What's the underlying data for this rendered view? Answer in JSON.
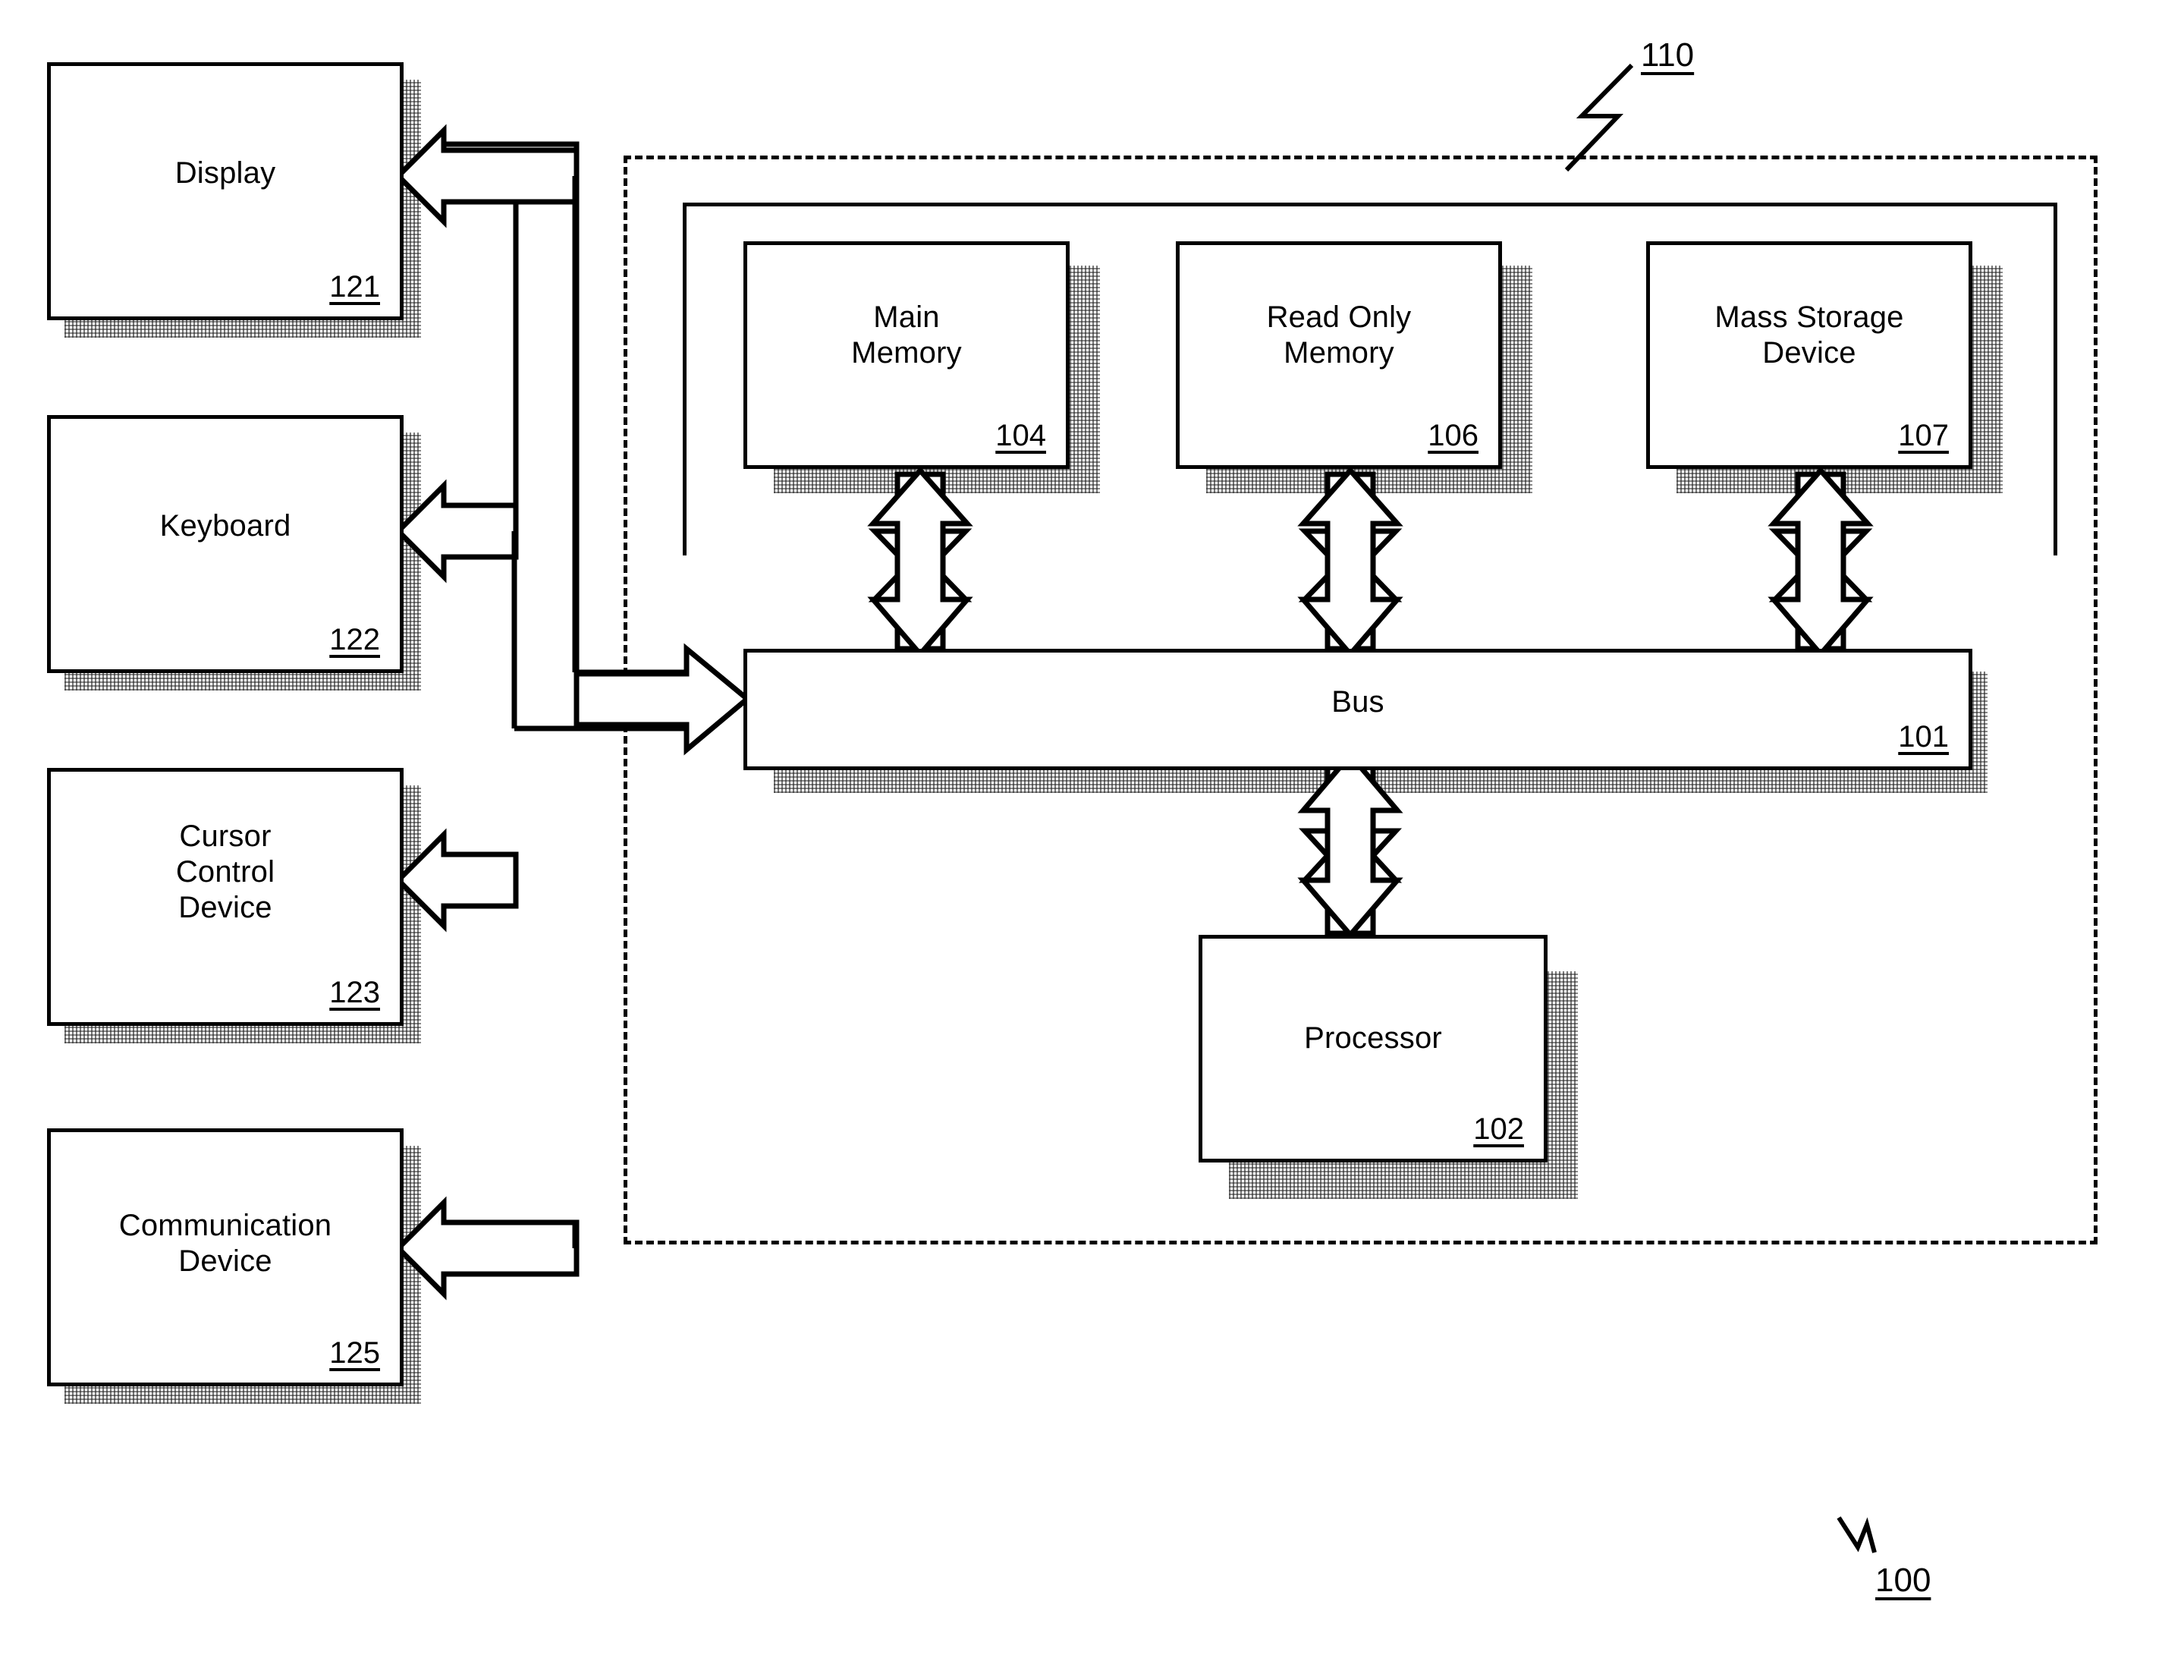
{
  "figure": {
    "system_label": "110",
    "figure_label": "100"
  },
  "peripherals": [
    {
      "name": "Display",
      "ref": "121"
    },
    {
      "name": "Keyboard",
      "ref": "122"
    },
    {
      "name": "Cursor\nControl\nDevice",
      "ref": "123"
    },
    {
      "name": "Communication\nDevice",
      "ref": "125"
    }
  ],
  "memory_group": [
    {
      "name": "Main\nMemory",
      "ref": "104"
    },
    {
      "name": "Read Only\nMemory",
      "ref": "106"
    },
    {
      "name": "Mass Storage\nDevice",
      "ref": "107"
    }
  ],
  "bus": {
    "name": "Bus",
    "ref": "101"
  },
  "processor": {
    "name": "Processor",
    "ref": "102"
  },
  "colors": {
    "ink": "#000000",
    "paper": "#ffffff"
  }
}
